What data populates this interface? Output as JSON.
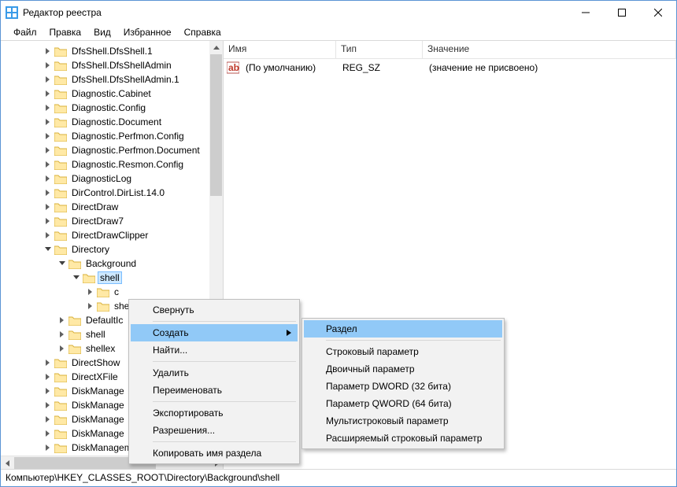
{
  "window": {
    "title": "Редактор реестра"
  },
  "menu": {
    "file": "Файл",
    "edit": "Правка",
    "view": "Вид",
    "favorites": "Избранное",
    "help": "Справка"
  },
  "tree": {
    "items": [
      {
        "indent": 3,
        "toggle": ">",
        "label": "DfsShell.DfsShell.1"
      },
      {
        "indent": 3,
        "toggle": ">",
        "label": "DfsShell.DfsShellAdmin"
      },
      {
        "indent": 3,
        "toggle": ">",
        "label": "DfsShell.DfsShellAdmin.1"
      },
      {
        "indent": 3,
        "toggle": ">",
        "label": "Diagnostic.Cabinet"
      },
      {
        "indent": 3,
        "toggle": ">",
        "label": "Diagnostic.Config"
      },
      {
        "indent": 3,
        "toggle": ">",
        "label": "Diagnostic.Document"
      },
      {
        "indent": 3,
        "toggle": ">",
        "label": "Diagnostic.Perfmon.Config"
      },
      {
        "indent": 3,
        "toggle": ">",
        "label": "Diagnostic.Perfmon.Document"
      },
      {
        "indent": 3,
        "toggle": ">",
        "label": "Diagnostic.Resmon.Config"
      },
      {
        "indent": 3,
        "toggle": ">",
        "label": "DiagnosticLog"
      },
      {
        "indent": 3,
        "toggle": ">",
        "label": "DirControl.DirList.14.0"
      },
      {
        "indent": 3,
        "toggle": ">",
        "label": "DirectDraw"
      },
      {
        "indent": 3,
        "toggle": ">",
        "label": "DirectDraw7"
      },
      {
        "indent": 3,
        "toggle": ">",
        "label": "DirectDrawClipper"
      },
      {
        "indent": 3,
        "toggle": "v",
        "label": "Directory"
      },
      {
        "indent": 4,
        "toggle": "v",
        "label": "Background"
      },
      {
        "indent": 5,
        "toggle": "v",
        "label": "shell",
        "selected": true
      },
      {
        "indent": 6,
        "toggle": ">",
        "label": "c"
      },
      {
        "indent": 6,
        "toggle": ">",
        "label": "shell"
      },
      {
        "indent": 4,
        "toggle": ">",
        "label": "DefaultIc"
      },
      {
        "indent": 4,
        "toggle": ">",
        "label": "shell"
      },
      {
        "indent": 4,
        "toggle": ">",
        "label": "shellex"
      },
      {
        "indent": 3,
        "toggle": ">",
        "label": "DirectShow"
      },
      {
        "indent": 3,
        "toggle": ">",
        "label": "DirectXFile"
      },
      {
        "indent": 3,
        "toggle": ">",
        "label": "DiskManage"
      },
      {
        "indent": 3,
        "toggle": ">",
        "label": "DiskManage"
      },
      {
        "indent": 3,
        "toggle": ">",
        "label": "DiskManage"
      },
      {
        "indent": 3,
        "toggle": ">",
        "label": "DiskManage"
      },
      {
        "indent": 3,
        "toggle": ">",
        "label": "DiskManagement.SnapInAbout"
      }
    ]
  },
  "listHeader": {
    "name": "Имя",
    "type": "Тип",
    "value": "Значение"
  },
  "listRows": [
    {
      "name": "(По умолчанию)",
      "type": "REG_SZ",
      "value": "(значение не присвоено)"
    }
  ],
  "contextMenu": {
    "collapse": "Свернуть",
    "create": "Создать",
    "find": "Найти...",
    "delete": "Удалить",
    "rename": "Переименовать",
    "export": "Экспортировать",
    "permissions": "Разрешения...",
    "copyKeyName": "Копировать имя раздела"
  },
  "submenu": {
    "key": "Раздел",
    "string": "Строковый параметр",
    "binary": "Двоичный параметр",
    "dword": "Параметр DWORD (32 бита)",
    "qword": "Параметр QWORD (64 бита)",
    "multi": "Мультистроковый параметр",
    "expand": "Расширяемый строковый параметр"
  },
  "statusbar": {
    "path": "Компьютер\\HKEY_CLASSES_ROOT\\Directory\\Background\\shell"
  }
}
